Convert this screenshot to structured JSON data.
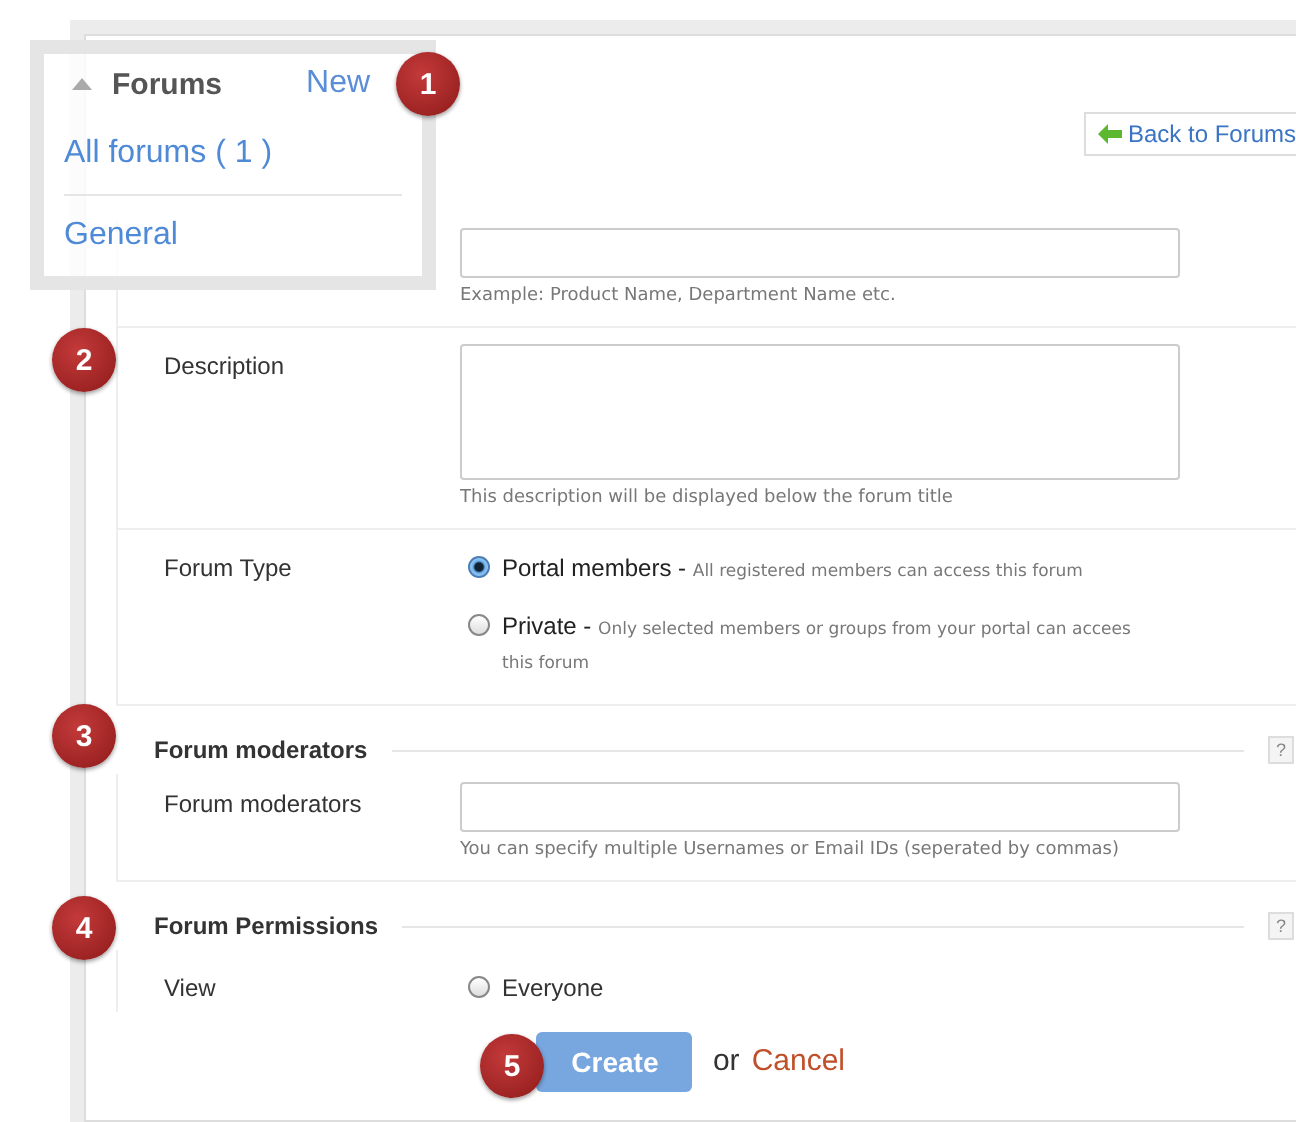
{
  "header": {
    "back_button": "Back to Forums"
  },
  "name_field": {
    "hint": "Example: Product Name, Department Name etc."
  },
  "description_field": {
    "label": "Description",
    "hint": "This description will be displayed below the forum title"
  },
  "forum_type": {
    "label": "Forum Type",
    "options": [
      {
        "label": "Portal members -",
        "note": "All registered members can access this forum",
        "selected": true
      },
      {
        "label": "Private -",
        "note": "Only selected members or groups from your portal can accees this forum",
        "selected": false
      }
    ]
  },
  "moderators": {
    "title": "Forum moderators",
    "help": "?",
    "label": "Forum moderators",
    "hint": "You can specify multiple Usernames or Email IDs (seperated by commas)"
  },
  "permissions": {
    "title": "Forum Permissions",
    "help": "?",
    "rows": [
      {
        "label": "View",
        "options": [
          {
            "label": "Everyone",
            "selected": false
          }
        ]
      }
    ]
  },
  "footer": {
    "create": "Create",
    "or": "or",
    "cancel": "Cancel"
  },
  "popup": {
    "title": "Forums",
    "new_link": "New",
    "items": [
      "All forums ( 1 )",
      "General"
    ]
  },
  "callouts": [
    "1",
    "2",
    "3",
    "4",
    "5"
  ]
}
